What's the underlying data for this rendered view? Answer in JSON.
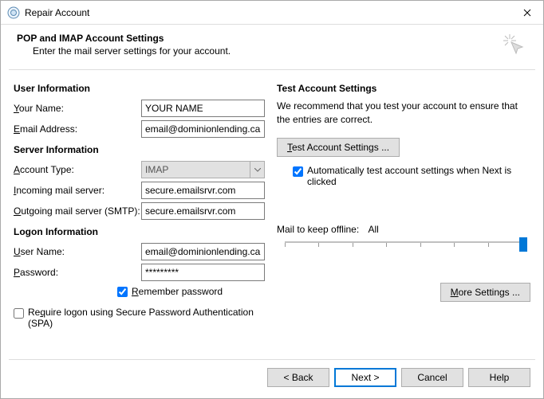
{
  "window": {
    "title": "Repair Account"
  },
  "header": {
    "title": "POP and IMAP Account Settings",
    "subtitle": "Enter the mail server settings for your account."
  },
  "left": {
    "user_info_title": "User Information",
    "your_name_label": "Your Name:",
    "your_name_value": "YOUR NAME",
    "email_label": "Email Address:",
    "email_value": "email@dominionlending.ca",
    "server_info_title": "Server Information",
    "account_type_label": "Account Type:",
    "account_type_value": "IMAP",
    "incoming_label": "Incoming mail server:",
    "incoming_value": "secure.emailsrvr.com",
    "outgoing_label": "Outgoing mail server (SMTP):",
    "outgoing_value": "secure.emailsrvr.com",
    "logon_info_title": "Logon Information",
    "user_name_label": "User Name:",
    "user_name_value": "email@dominionlending.ca",
    "password_label": "Password:",
    "password_value": "*********",
    "remember_password_label": "Remember password",
    "require_spa_label": "Require logon using Secure Password Authentication (SPA)"
  },
  "right": {
    "test_title": "Test Account Settings",
    "recommend_text": "We recommend that you test your account to ensure that the entries are correct.",
    "test_button": "Test Account Settings ...",
    "auto_test_label": "Automatically test account settings when Next is clicked",
    "mail_keep_label": "Mail to keep offline:",
    "mail_keep_value": "All",
    "more_settings": "More Settings ..."
  },
  "footer": {
    "back": "< Back",
    "next": "Next >",
    "cancel": "Cancel",
    "help": "Help"
  }
}
